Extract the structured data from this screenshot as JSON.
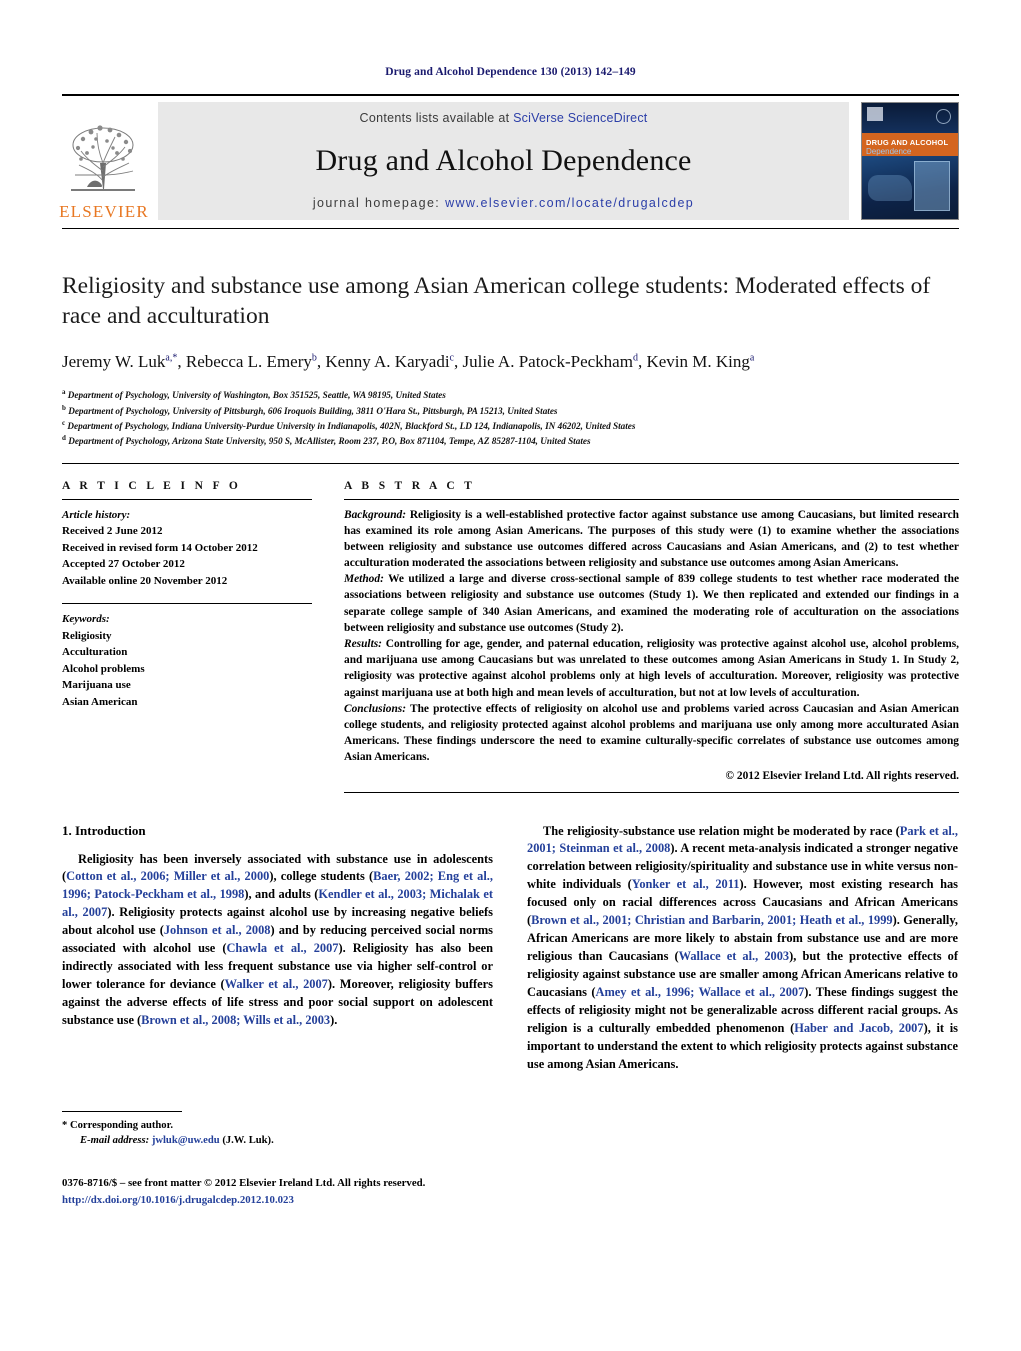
{
  "running_head": "Drug and Alcohol Dependence 130 (2013) 142–149",
  "masthead": {
    "publisher_name": "ELSEVIER",
    "contents_prefix": "Contents lists available at ",
    "sciencedirect_link": "SciVerse ScienceDirect",
    "journal_title": "Drug and Alcohol Dependence",
    "homepage_prefix": "journal homepage: ",
    "homepage_url": "www.elsevier.com/locate/drugalcdep",
    "cover_title_line1": "DRUG AND ALCOHOL",
    "cover_title_line2": "Dependence"
  },
  "article": {
    "title": "Religiosity and substance use among Asian American college students: Moderated effects of race and acculturation",
    "authors_html": "Jeremy W. Luk<sup>a,*</sup>, Rebecca L. Emery<sup>b</sup>, Kenny A. Karyadi<sup>c</sup>, Julie A. Patock-Peckham<sup>d</sup>, Kevin M. King<sup>a</sup>",
    "affiliations": [
      "Department of Psychology, University of Washington, Box 351525, Seattle, WA 98195, United States",
      "Department of Psychology, University of Pittsburgh, 606 Iroquois Building, 3811 O'Hara St., Pittsburgh, PA 15213, United States",
      "Department of Psychology, Indiana University-Purdue University in Indianapolis, 402N, Blackford St., LD 124, Indianapolis, IN 46202, United States",
      "Department of Psychology, Arizona State University, 950 S, McAllister, Room 237, P.O, Box 871104, Tempe, AZ 85287-1104, United States"
    ],
    "affiliation_markers": [
      "a",
      "b",
      "c",
      "d"
    ]
  },
  "article_info": {
    "heading": "A R T I C L E   I N F O",
    "history_label": "Article history:",
    "history": [
      "Received 2 June 2012",
      "Received in revised form 14 October 2012",
      "Accepted 27 October 2012",
      "Available online 20 November 2012"
    ],
    "keywords_label": "Keywords:",
    "keywords": [
      "Religiosity",
      "Acculturation",
      "Alcohol problems",
      "Marijuana use",
      "Asian American"
    ]
  },
  "abstract": {
    "heading": "A B S T R A C T",
    "background_label": "Background:",
    "background_text": " Religiosity is a well-established protective factor against substance use among Caucasians, but limited research has examined its role among Asian Americans. The purposes of this study were (1) to examine whether the associations between religiosity and substance use outcomes differed across Caucasians and Asian Americans, and (2) to test whether acculturation moderated the associations between religiosity and substance use outcomes among Asian Americans.",
    "method_label": "Method:",
    "method_text": " We utilized a large and diverse cross-sectional sample of 839 college students to test whether race moderated the associations between religiosity and substance use outcomes (Study 1). We then replicated and extended our findings in a separate college sample of 340 Asian Americans, and examined the moderating role of acculturation on the associations between religiosity and substance use outcomes (Study 2).",
    "results_label": "Results:",
    "results_text": " Controlling for age, gender, and paternal education, religiosity was protective against alcohol use, alcohol problems, and marijuana use among Caucasians but was unrelated to these outcomes among Asian Americans in Study 1. In Study 2, religiosity was protective against alcohol problems only at high levels of acculturation. Moreover, religiosity was protective against marijuana use at both high and mean levels of acculturation, but not at low levels of acculturation.",
    "conclusions_label": "Conclusions:",
    "conclusions_text": " The protective effects of religiosity on alcohol use and problems varied across Caucasian and Asian American college students, and religiosity protected against alcohol problems and marijuana use only among more acculturated Asian Americans. These findings underscore the need to examine culturally-specific correlates of substance use outcomes among Asian Americans.",
    "copyright": "© 2012 Elsevier Ireland Ltd. All rights reserved."
  },
  "introduction": {
    "heading": "1.  Introduction",
    "left_paragraph_parts": [
      {
        "t": "Religiosity has been inversely associated with substance use in adolescents (",
        "c": false
      },
      {
        "t": "Cotton et al., 2006; Miller et al., 2000",
        "c": true
      },
      {
        "t": "), college students (",
        "c": false
      },
      {
        "t": "Baer, 2002; Eng et al., 1996; Patock-Peckham et al., 1998",
        "c": true
      },
      {
        "t": "), and adults (",
        "c": false
      },
      {
        "t": "Kendler et al., 2003; Michalak et al., 2007",
        "c": true
      },
      {
        "t": "). Religiosity protects against alcohol use by increasing negative beliefs about alcohol use (",
        "c": false
      },
      {
        "t": "Johnson et al., 2008",
        "c": true
      },
      {
        "t": ") and by reducing perceived social norms associated with alcohol use (",
        "c": false
      },
      {
        "t": "Chawla et al., 2007",
        "c": true
      },
      {
        "t": "). Religiosity has also been indirectly associated with less frequent substance use via higher self-control or lower tolerance for deviance (",
        "c": false
      },
      {
        "t": "Walker et al., 2007",
        "c": true
      },
      {
        "t": "). Moreover, religiosity buffers against the adverse effects of life stress and poor social support on adolescent substance use (",
        "c": false
      },
      {
        "t": "Brown et al., 2008; Wills et al., 2003",
        "c": true
      },
      {
        "t": ").",
        "c": false
      }
    ],
    "right_paragraph_parts": [
      {
        "t": "The religiosity-substance use relation might be moderated by race (",
        "c": false
      },
      {
        "t": "Park et al., 2001; Steinman et al., 2008",
        "c": true
      },
      {
        "t": "). A recent meta-analysis indicated a stronger negative correlation between religiosity/spirituality and substance use in white versus non-white individuals (",
        "c": false
      },
      {
        "t": "Yonker et al., 2011",
        "c": true
      },
      {
        "t": "). However, most existing research has focused only on racial differences across Caucasians and African Americans (",
        "c": false
      },
      {
        "t": "Brown et al., 2001; Christian and Barbarin, 2001; Heath et al., 1999",
        "c": true
      },
      {
        "t": "). Generally, African Americans are more likely to abstain from substance use and are more religious than Caucasians (",
        "c": false
      },
      {
        "t": "Wallace et al., 2003",
        "c": true
      },
      {
        "t": "), but the protective effects of religiosity against substance use are smaller among African Americans relative to Caucasians (",
        "c": false
      },
      {
        "t": "Amey et al., 1996; Wallace et al., 2007",
        "c": true
      },
      {
        "t": "). These findings suggest the effects of religiosity might not be generalizable across different racial groups. As religion is a culturally embedded phenomenon (",
        "c": false
      },
      {
        "t": "Haber and Jacob, 2007",
        "c": true
      },
      {
        "t": "), it is important to understand the extent to which religiosity protects against substance use among Asian Americans.",
        "c": false
      }
    ]
  },
  "footnotes": {
    "corresponding_marker": "*",
    "corresponding_label": "Corresponding author.",
    "email_label": "E-mail address:",
    "email": "jwluk@uw.edu",
    "email_suffix": " (J.W. Luk)."
  },
  "footer": {
    "issn_line": "0376-8716/$ – see front matter © 2012 Elsevier Ireland Ltd. All rights reserved.",
    "doi": "http://dx.doi.org/10.1016/j.drugalcdep.2012.10.023"
  },
  "colors": {
    "link_blue": "#24409a",
    "header_navy": "#1a1a6e",
    "elsevier_orange": "#e87722",
    "banner_gray": "#e8e8e8"
  }
}
